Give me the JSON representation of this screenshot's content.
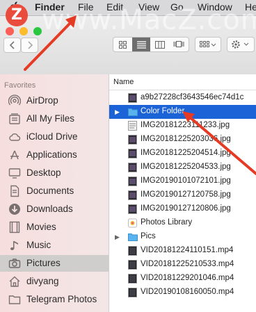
{
  "menubar": {
    "app_name": "Finder",
    "items": [
      "File",
      "Edit",
      "View",
      "Go",
      "Window",
      "He"
    ]
  },
  "watermark": {
    "text": "www.MacZ.com",
    "logo_letter": "Z"
  },
  "toolbar": {
    "back_icon": "chevron-left-icon",
    "forward_icon": "chevron-right-icon",
    "views": [
      "icon-view",
      "list-view",
      "column-view",
      "cover-flow-view"
    ],
    "arrange_icon": "arrange-grid-icon",
    "action_icon": "gear-icon"
  },
  "sidebar": {
    "heading": "Favorites",
    "items": [
      {
        "label": "AirDrop",
        "icon": "airdrop-icon"
      },
      {
        "label": "All My Files",
        "icon": "all-files-icon"
      },
      {
        "label": "iCloud Drive",
        "icon": "cloud-icon"
      },
      {
        "label": "Applications",
        "icon": "applications-icon"
      },
      {
        "label": "Desktop",
        "icon": "desktop-icon"
      },
      {
        "label": "Documents",
        "icon": "documents-icon"
      },
      {
        "label": "Downloads",
        "icon": "downloads-icon"
      },
      {
        "label": "Movies",
        "icon": "movies-icon"
      },
      {
        "label": "Music",
        "icon": "music-icon"
      },
      {
        "label": "Pictures",
        "icon": "camera-icon",
        "selected": true
      },
      {
        "label": "divyang",
        "icon": "home-icon"
      },
      {
        "label": "Telegram Photos",
        "icon": "folder-icon"
      }
    ]
  },
  "file_list": {
    "column_header": "Name",
    "rows": [
      {
        "name": "a9b27228cf3643546ec74d1c",
        "kind": "image-dark"
      },
      {
        "name": "Color Folder",
        "kind": "folder",
        "selected": true,
        "expandable": true
      },
      {
        "name": "IMG20181223111233.jpg",
        "kind": "image-doc"
      },
      {
        "name": "IMG20181225203036.jpg",
        "kind": "image-dark"
      },
      {
        "name": "IMG20181225204514.jpg",
        "kind": "image-dark"
      },
      {
        "name": "IMG20181225204533.jpg",
        "kind": "image-dark"
      },
      {
        "name": "IMG20190101072101.jpg",
        "kind": "image-dark"
      },
      {
        "name": "IMG20190127120758.jpg",
        "kind": "image-dark"
      },
      {
        "name": "IMG20190127120806.jpg",
        "kind": "image-dark"
      },
      {
        "name": "Photos Library",
        "kind": "library"
      },
      {
        "name": "Pics",
        "kind": "folder",
        "expandable": true
      },
      {
        "name": "VID20181224110151.mp4",
        "kind": "video"
      },
      {
        "name": "VID20181225210533.mp4",
        "kind": "video"
      },
      {
        "name": "VID20181229201046.mp4",
        "kind": "video"
      },
      {
        "name": "VID20190108160050.mp4",
        "kind": "video"
      }
    ]
  },
  "colors": {
    "selection": "#1d63d8",
    "annotation_arrow": "#e53a24",
    "folder": "#5ab2ee"
  }
}
